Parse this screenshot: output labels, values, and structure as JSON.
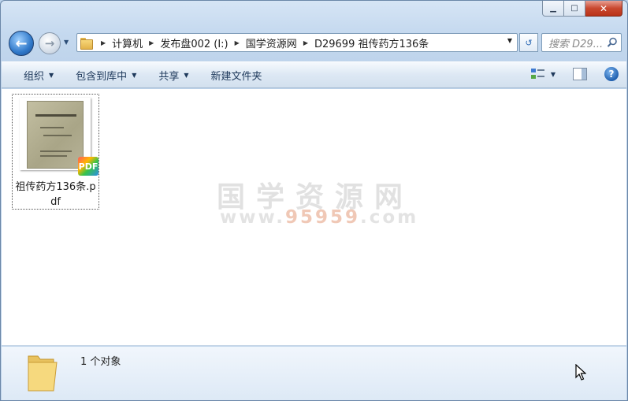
{
  "window": {
    "minimize_label": "▁",
    "maximize_label": "□",
    "close_label": "✕"
  },
  "nav": {
    "back_glyph": "←",
    "forward_glyph": "→",
    "history_glyph": "▼",
    "breadcrumbs": [
      {
        "label": "计算机"
      },
      {
        "label": "发布盘002 (I:)"
      },
      {
        "label": "国学资源网"
      },
      {
        "label": "D29699 祖传药方136条"
      }
    ],
    "dropdown_glyph": "▼",
    "refresh_glyph": "↺",
    "search_placeholder": "搜索 D29..."
  },
  "toolbar": {
    "items": [
      {
        "label": "组织",
        "has_arrow": true
      },
      {
        "label": "包含到库中",
        "has_arrow": true
      },
      {
        "label": "共享",
        "has_arrow": true
      },
      {
        "label": "新建文件夹",
        "has_arrow": false
      }
    ],
    "arrow_glyph": "▼",
    "help_glyph": "?"
  },
  "files": [
    {
      "name": "祖传药方136条.pdf",
      "badge": "PDF"
    }
  ],
  "watermark": {
    "chinese": "国学资源网",
    "url_prefix": "www.",
    "url_highlight": "95959",
    "url_suffix": ".com"
  },
  "status": {
    "text": "1 个对象"
  },
  "colors": {
    "accent": "#2f78c9",
    "folder": "#e3b34a",
    "watermark": "#e1e1e1"
  }
}
